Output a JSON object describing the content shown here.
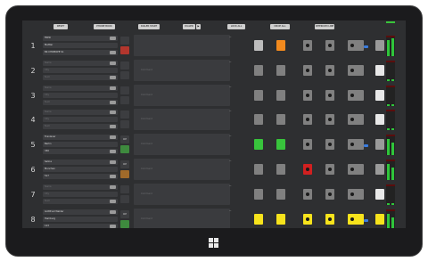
{
  "topbar": {
    "buttons": [
      "RESET",
      "PHONE BOOK",
      "DIALER START",
      "DIALER",
      "LOCK ALL",
      "DROP ALL",
      "INTERCOM LINE"
    ],
    "dialer_arrow": "▶"
  },
  "rows": [
    {
      "number": "1",
      "name": "FRED",
      "city": "Mettler",
      "number_line": "BK CHRMOPE S1",
      "status": "",
      "note": "",
      "state": "live_orange"
    },
    {
      "number": "2",
      "name": "Name",
      "city": "City",
      "number_line": "Num",
      "status": "",
      "note": "Comment",
      "state": "empty"
    },
    {
      "number": "3",
      "name": "Name",
      "city": "City",
      "number_line": "Num",
      "status": "",
      "note": "Comment",
      "state": "empty"
    },
    {
      "number": "4",
      "name": "Name",
      "city": "City",
      "number_line": "Num",
      "status": "",
      "note": "Comment",
      "state": "empty"
    },
    {
      "number": "5",
      "name": "Tcenlaner",
      "city": "Berlin",
      "number_line": "330",
      "status": "OP",
      "note": "Comment",
      "state": "green"
    },
    {
      "number": "6",
      "name": "Selina",
      "city": "Munchen",
      "number_line": "517",
      "status": "OP",
      "note": "Comment",
      "state": "red"
    },
    {
      "number": "7",
      "name": "Name",
      "city": "City",
      "number_line": "Num",
      "status": "",
      "note": "Comment",
      "state": "empty"
    },
    {
      "number": "8",
      "name": "Gottfried Walder",
      "city": "Hamburg",
      "number_line": "123",
      "status": "OP",
      "note": "Comment",
      "state": "yellow"
    }
  ],
  "colors": {
    "orange": "#f28a1e",
    "green": "#38c43c",
    "red": "#d12020",
    "yellow": "#f7e31c",
    "grey": "#7e7e7e",
    "meter": "#2fc53a"
  },
  "icons": {
    "windows": "windows-logo-icon",
    "circle": "dot-icon"
  }
}
